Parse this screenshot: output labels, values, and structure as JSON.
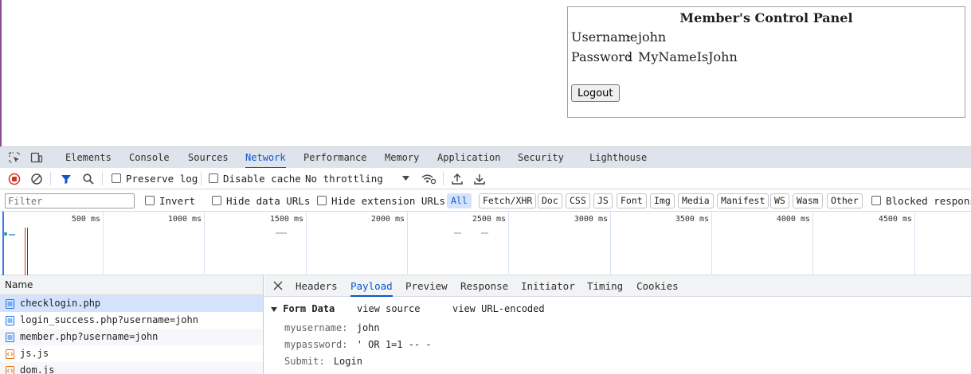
{
  "panel": {
    "title": "Member's Control Panel",
    "username_label": "Username",
    "username_sep": ":",
    "username_value": "john",
    "password_label": "Password",
    "password_sep": ":",
    "password_value": "MyNameIsJohn",
    "logout_label": "Logout"
  },
  "devtools": {
    "tabs": [
      "Elements",
      "Console",
      "Sources",
      "Network",
      "Performance",
      "Memory",
      "Application",
      "Security",
      "Lighthouse"
    ],
    "active_tab": "Network",
    "toolbar": {
      "preserve_log": "Preserve log",
      "disable_cache": "Disable cache",
      "throttling": "No throttling"
    },
    "filterbar": {
      "filter_placeholder": "Filter",
      "invert": "Invert",
      "hide_data_urls": "Hide data URLs",
      "hide_extension_urls": "Hide extension URLs",
      "chips": [
        "All",
        "Fetch/XHR",
        "Doc",
        "CSS",
        "JS",
        "Font",
        "Img",
        "Media",
        "Manifest",
        "WS",
        "Wasm",
        "Other"
      ],
      "active_chip": "All",
      "blocked_responses": "Blocked response"
    },
    "overview_ticks": [
      "500 ms",
      "1000 ms",
      "1500 ms",
      "2000 ms",
      "2500 ms",
      "3000 ms",
      "3500 ms",
      "4000 ms",
      "4500 ms"
    ],
    "requests_header": "Name",
    "requests": [
      {
        "name": "checklogin.php",
        "type": "doc",
        "selected": true
      },
      {
        "name": "login_success.php?username=john",
        "type": "doc",
        "selected": false
      },
      {
        "name": "member.php?username=john",
        "type": "doc",
        "selected": false
      },
      {
        "name": "js.js",
        "type": "script",
        "selected": false
      },
      {
        "name": "dom.js",
        "type": "script",
        "selected": false
      }
    ],
    "detail_tabs": [
      "Headers",
      "Payload",
      "Preview",
      "Response",
      "Initiator",
      "Timing",
      "Cookies"
    ],
    "active_detail_tab": "Payload",
    "form_data": {
      "title": "Form Data",
      "view_source": "view source",
      "view_url_encoded": "view URL-encoded",
      "fields": [
        {
          "key": "myusername:",
          "value": "john"
        },
        {
          "key": "mypassword:",
          "value": "' OR 1=1 -- -"
        },
        {
          "key": "Submit:",
          "value": "Login"
        }
      ]
    }
  },
  "colors": {
    "accent": "#0b57d0",
    "tab_bar": "#dee3ec",
    "selected_row": "#d3e3fd",
    "record_red": "#d93025"
  }
}
